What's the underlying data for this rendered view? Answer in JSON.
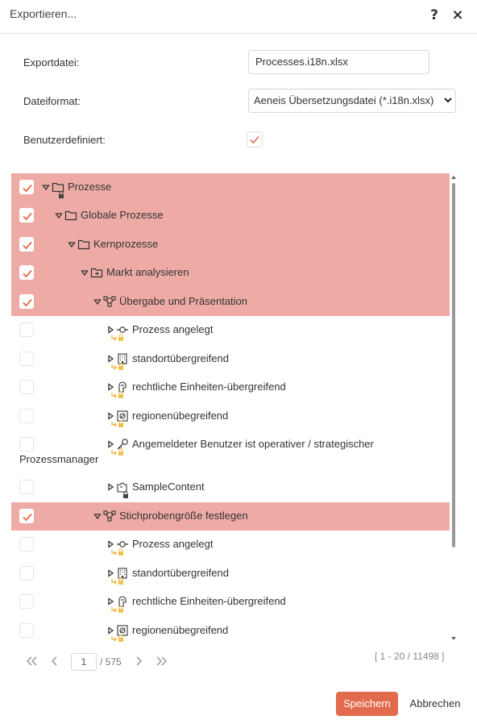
{
  "dialog": {
    "title": "Exportieren...",
    "help_icon": "?",
    "close_icon": "×"
  },
  "form": {
    "export_file_label": "Exportdatei:",
    "export_file_value": "Processes.i18n.xlsx",
    "format_label": "Dateiformat:",
    "format_value": "Aeneis Übersetzungsdatei (*.i18n.xlsx)",
    "custom_label": "Benutzerdefiniert:",
    "custom_checked": true
  },
  "colors": {
    "accent": "#e36b4d",
    "selected_row": "#eeaba5",
    "lock": "#f2c14e"
  },
  "tree": [
    {
      "label": "Prozesse",
      "icon": "folder-icon",
      "checked": true,
      "expanded": true,
      "badge": "lock-icon"
    },
    {
      "label": "Globale Prozesse",
      "icon": "folder-icon",
      "checked": true,
      "expanded": true
    },
    {
      "label": "Kernprozesse",
      "icon": "folder-icon",
      "checked": true,
      "expanded": true
    },
    {
      "label": "Markt analysieren",
      "icon": "folder-arrow-icon",
      "checked": true,
      "expanded": true
    },
    {
      "label": "Übergabe und Präsentation",
      "icon": "process-map-icon",
      "checked": true,
      "expanded": true
    },
    {
      "label": "Prozess angelegt",
      "icon": "event-icon",
      "checked": false,
      "expanded": false,
      "badge": "link-lock-icon"
    },
    {
      "label": "standortübergreifend",
      "icon": "building-icon",
      "checked": false,
      "expanded": false,
      "badge": "link-lock-icon"
    },
    {
      "label": "rechtliche Einheiten-übergreifend",
      "icon": "legal-entity-icon",
      "checked": false,
      "expanded": false,
      "badge": "link-lock-icon"
    },
    {
      "label": "regionenübegreifend",
      "icon": "region-icon",
      "checked": false,
      "expanded": false,
      "badge": "link-lock-icon"
    },
    {
      "label": "Angemeldeter Benutzer ist operativer / strategischer",
      "label_cont": "Prozessmanager",
      "icon": "key-icon",
      "checked": false,
      "expanded": false,
      "badge": "link-lock-icon"
    },
    {
      "label": "SampleContent",
      "icon": "puzzle-icon",
      "checked": false,
      "expanded": false,
      "badge": "lock-icon"
    },
    {
      "label": "Stichprobengröße festlegen",
      "icon": "process-map-icon",
      "checked": true,
      "expanded": true
    },
    {
      "label": "Prozess angelegt",
      "icon": "event-icon",
      "checked": false,
      "expanded": false,
      "badge": "link-lock-icon"
    },
    {
      "label": "standortübergreifend",
      "icon": "building-icon",
      "checked": false,
      "expanded": false,
      "badge": "link-lock-icon"
    },
    {
      "label": "rechtliche Einheiten-übergreifend",
      "icon": "legal-entity-icon",
      "checked": false,
      "expanded": false,
      "badge": "link-lock-icon"
    },
    {
      "label": "regionenübegreifend",
      "icon": "region-icon",
      "checked": false,
      "expanded": false,
      "badge": "link-lock-icon"
    }
  ],
  "pagination": {
    "current_page": "1",
    "total_pages": "/ 575",
    "range": "[ 1 - 20 / 11498 ]"
  },
  "footer": {
    "save_label": "Speichern",
    "cancel_label": "Abbrechen"
  }
}
